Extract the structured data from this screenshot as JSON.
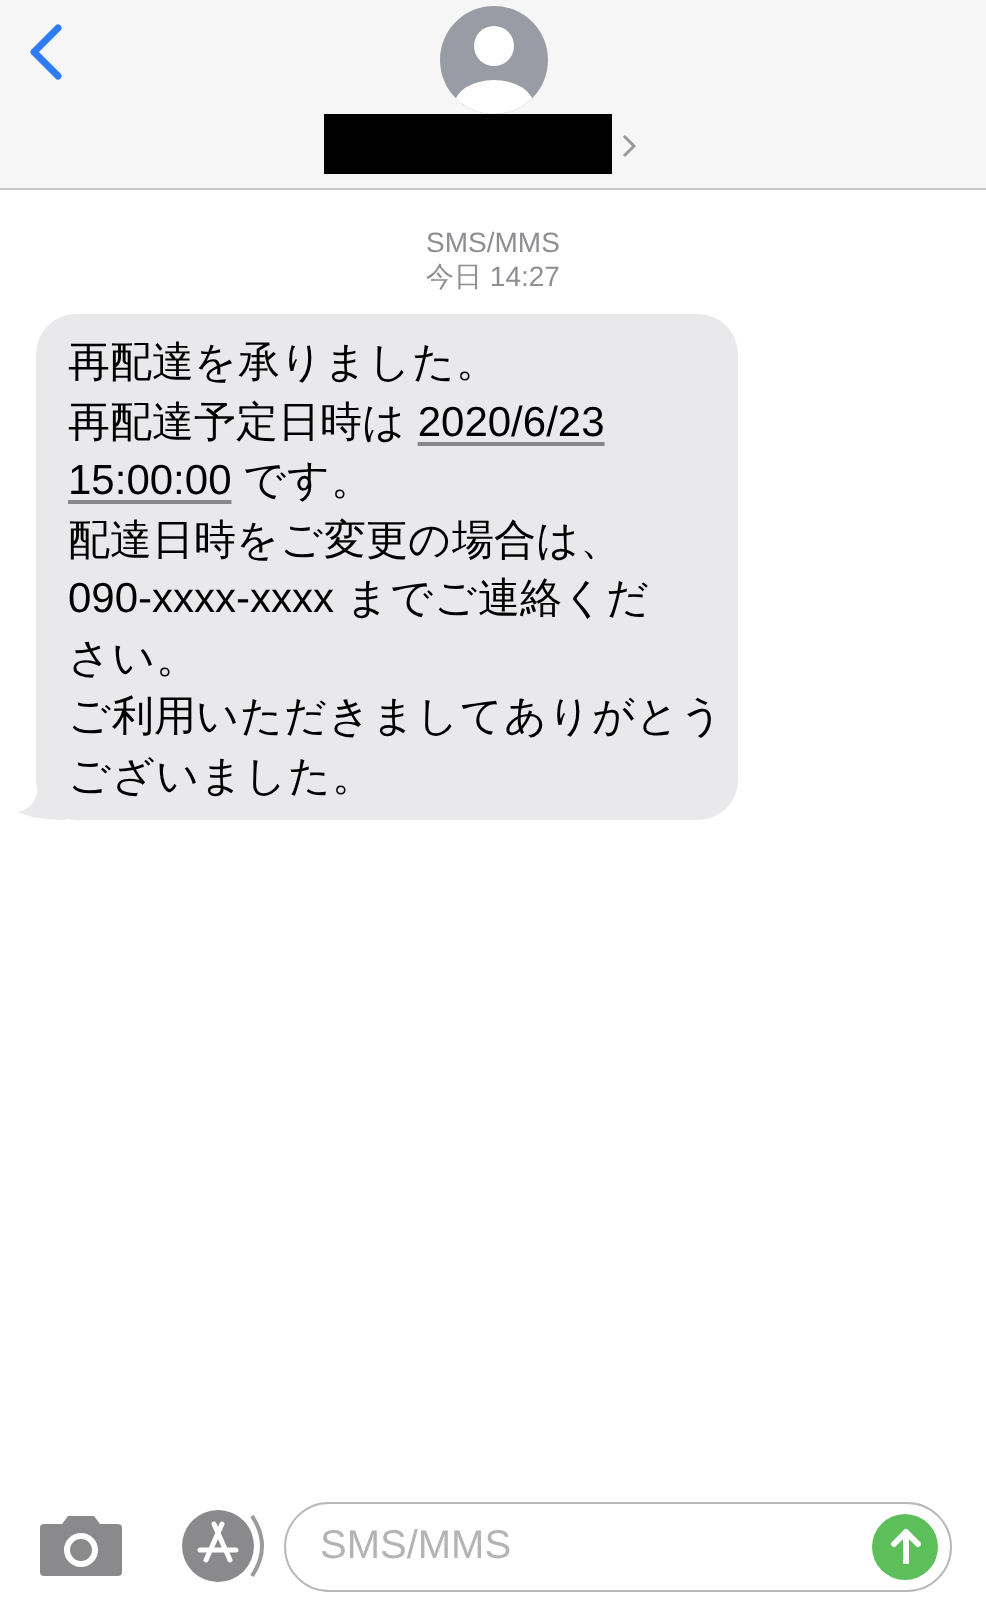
{
  "conversation": {
    "service": "SMS/MMS",
    "timestamp": "今日 14:27"
  },
  "message": {
    "lines": [
      [
        {
          "text": "再配達を承りました。",
          "link": false
        }
      ],
      [
        {
          "text": "再配達予定日時は ",
          "link": false
        },
        {
          "text": "2020/6/23",
          "link": true
        }
      ],
      [
        {
          "text": "15:00:00",
          "link": true
        },
        {
          "text": " です。",
          "link": false
        }
      ],
      [
        {
          "text": "配達日時をご変更の場合は、",
          "link": false
        }
      ],
      [
        {
          "text": "090-xxxx-xxxx までご連絡くだ",
          "link": false
        }
      ],
      [
        {
          "text": "さい。",
          "link": false
        }
      ],
      [
        {
          "text": "ご利用いただきましてありがとう",
          "link": false
        }
      ],
      [
        {
          "text": "ございました。",
          "link": false
        }
      ]
    ]
  },
  "composer": {
    "placeholder": "SMS/MMS"
  }
}
